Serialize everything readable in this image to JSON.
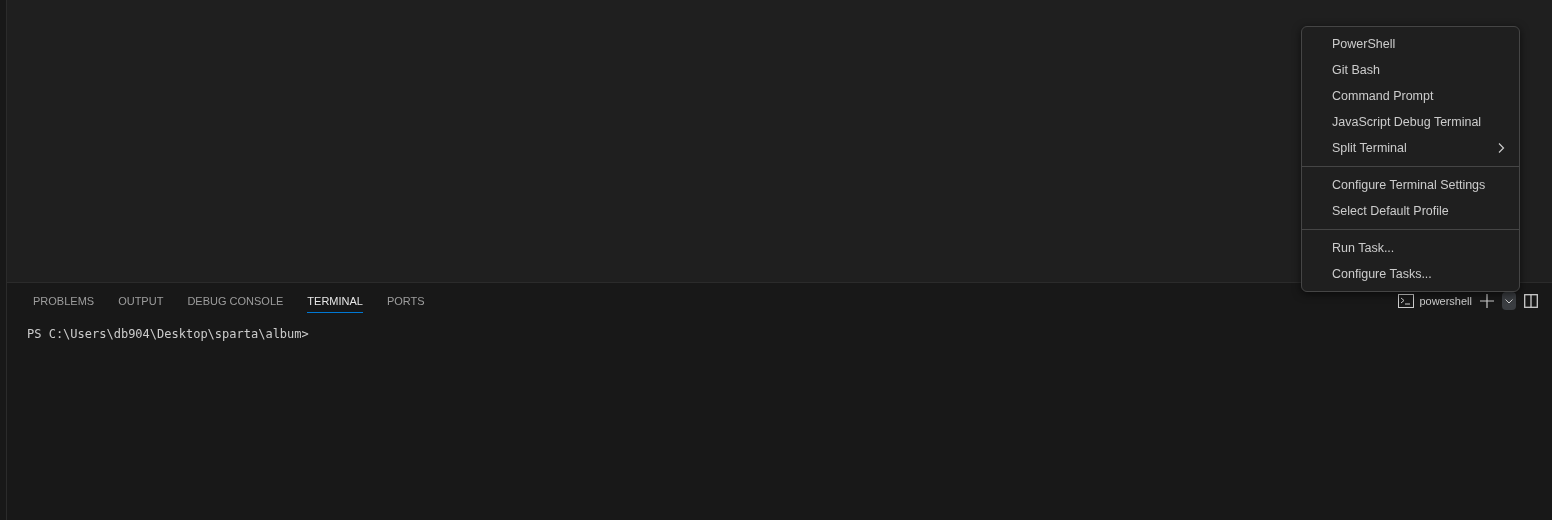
{
  "panel": {
    "tabs": [
      {
        "label": "PROBLEMS",
        "selected": false
      },
      {
        "label": "OUTPUT",
        "selected": false
      },
      {
        "label": "DEBUG CONSOLE",
        "selected": false
      },
      {
        "label": "TERMINAL",
        "selected": true
      },
      {
        "label": "PORTS",
        "selected": false
      }
    ],
    "terminal_profile": "powershell",
    "terminal_lines": [
      "PS C:\\Users\\db904\\Desktop\\sparta\\album>"
    ]
  },
  "dropdown_menu": {
    "groups": [
      [
        {
          "label": "PowerShell",
          "submenu": false
        },
        {
          "label": "Git Bash",
          "submenu": false
        },
        {
          "label": "Command Prompt",
          "submenu": false
        },
        {
          "label": "JavaScript Debug Terminal",
          "submenu": false
        },
        {
          "label": "Split Terminal",
          "submenu": true
        }
      ],
      [
        {
          "label": "Configure Terminal Settings",
          "submenu": false
        },
        {
          "label": "Select Default Profile",
          "submenu": false
        }
      ],
      [
        {
          "label": "Run Task...",
          "submenu": false
        },
        {
          "label": "Configure Tasks...",
          "submenu": false
        }
      ]
    ]
  }
}
